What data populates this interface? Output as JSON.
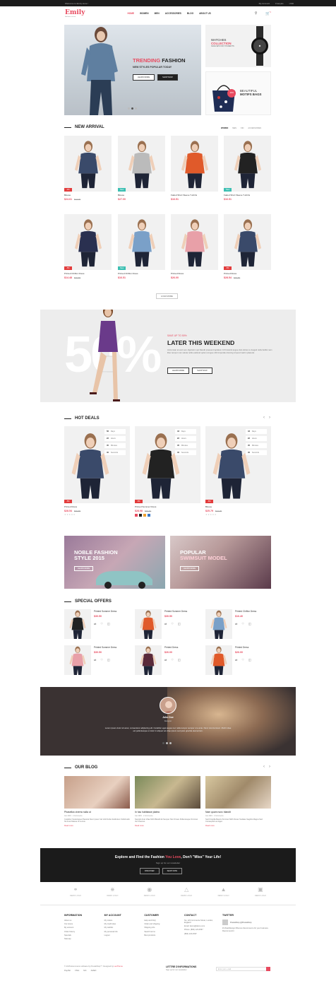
{
  "topbar": {
    "welcome": "Welcome to Emily store !",
    "account": "My Account",
    "language": "Français",
    "currency": "USD"
  },
  "header": {
    "logo": "Emily",
    "tagline": "fashion store",
    "nav": [
      "HOME",
      "WOMEN",
      "MEN",
      "ACCESSORIES",
      "BLOG",
      "ABOUT US"
    ],
    "cart_count": "0"
  },
  "hero": {
    "title_pink": "TRENDING",
    "title_dark": "FASHION",
    "subtitle": "NEW STYLES POPULAR TODAY",
    "btn_learn": "LEARN MORE",
    "btn_shop": "SHOP NOW"
  },
  "side1": {
    "l1": "WATCHES",
    "l2": "COLLECTION",
    "l3": "SAVE $25 FOR STUDENTS"
  },
  "side2": {
    "badge": "-30%",
    "l1": "BEAUTIFUL",
    "l2": "MOTIFS BAGS"
  },
  "new_arrival": {
    "title": "NEW ARRIVAL",
    "tabs": [
      "WOMEN",
      "MEN",
      "KID",
      "ACCESSORIES"
    ],
    "products": [
      {
        "name": "Blouse",
        "price": "$24.61",
        "old": "$27.00",
        "badge": "-1%"
      },
      {
        "name": "Blouse",
        "price": "$27.00",
        "old": "",
        "badge": "New"
      },
      {
        "name": "Faded Short Sleeve T-shirts",
        "price": "$16.51",
        "old": "",
        "badge": ""
      },
      {
        "name": "Faded Short Sleeve T-shirts",
        "price": "$16.51",
        "old": "",
        "badge": "New"
      },
      {
        "name": "Printed Chiffon Dress",
        "price": "$14.48",
        "old": "$20.50",
        "badge": "-5%"
      },
      {
        "name": "Printed Chiffon Dress",
        "price": "$16.51",
        "old": "",
        "badge": "New"
      },
      {
        "name": "Printed Dress",
        "price": "$26.00",
        "old": "",
        "badge": ""
      },
      {
        "name": "Printed Dress",
        "price": "$28.54",
        "old": "$30.50",
        "badge": "-5%"
      }
    ],
    "load_more": "LOAD MORE"
  },
  "promo": {
    "big": "50%",
    "save": "SAVE UP TO 50%",
    "title": "LATER THIS WEEKEND",
    "desc": "Accumsan at erat vero dignissim qui blandit praesent luptatum zzril delenit augue duis dolore te feugait nulla facilisi nam liber tempor cum soluta nobis eleifend option congue nihil imperdiet doming id quod mazim placerat.",
    "btn_learn": "LEARN MORE",
    "btn_shop": "SHOP NOW"
  },
  "hot_deals": {
    "title": "HOT DEALS",
    "count_labels": [
      "Days",
      "Hours",
      "Minutes",
      "Seconds"
    ],
    "items": [
      {
        "name": "Printed Dress",
        "price": "$28.54",
        "old": "$30.50",
        "badge": "-5%",
        "count": [
          "56",
          "22",
          "45",
          "40"
        ]
      },
      {
        "name": "Printed Summer Dress",
        "price": "$28.98",
        "old": "$30.51",
        "badge": "-5%",
        "count": [
          "43",
          "22",
          "45",
          "40"
        ]
      },
      {
        "name": "Blouse",
        "price": "$25.79",
        "old": "$27.00",
        "badge": "-5%",
        "count": [
          "43",
          "22",
          "45",
          "40"
        ]
      }
    ],
    "swatches": [
      "#e84a5f",
      "#222222",
      "#f0a030",
      "#3a78c8"
    ]
  },
  "banners": [
    {
      "l1": "NOBLE FASHION",
      "l2": "STYLE 2015",
      "btn": "LEARN MORE"
    },
    {
      "l1": "POPULAR",
      "l2": "SWIMSUIT MODEL",
      "btn": "LEARN MORE"
    }
  ],
  "special": {
    "title": "SPECIAL OFFERS",
    "items": [
      {
        "name": "Printed Summer Dress",
        "price": "$30.50"
      },
      {
        "name": "Printed Summer Dress",
        "price": "$30.50"
      },
      {
        "name": "Printed Chiffon Dress",
        "price": "$16.40"
      },
      {
        "name": "Printed Summer Dress",
        "price": "$30.50"
      },
      {
        "name": "Printed Dress",
        "price": "$26.00"
      },
      {
        "name": "Printed Dress",
        "price": "$26.00"
      }
    ]
  },
  "testimonial": {
    "name": "John Doe",
    "role": "Designer",
    "quote": "Lorem ipsum dolor sit amet, consectetur adipiscing elit. Curabitur eget augue nec nulla tempor semper ut a ante. Nunc viverra lorem. Morbi vitae est pellentesque ut dolor in aliquet vel vitae ipsum sed justo gravida elementum."
  },
  "blog": {
    "title": "OUR BLOG",
    "posts": [
      {
        "title": "Phasellus viverra nulla ut",
        "meta": "Jan 2015  ·  2 Comments",
        "desc": "Curabitur Scelerisque Placerat Nunc Ipsum Vel Velit Nulla Vestibulum Sollicitudin Sit Amet Massa Ut Luctus.",
        "more": "Read more"
      },
      {
        "title": "In hac habitasse platea",
        "meta": "Jan 2015  ·  2 Comments",
        "desc": "Suscipit Ante Vitae Nibh Blandit Et Semper Nisi Ornare Pellentesque Sit Amet Vel Vivamus.",
        "more": "Read more"
      },
      {
        "title": "Nam quam nunc blandit",
        "meta": "Jan 2015  ·  2 Comments",
        "desc": "Sed Fringilla Mauris Sit Amet Nibh Donec Sodales Sagittis Magna Sed Consequat Leo Eget.",
        "more": "Read more"
      }
    ]
  },
  "newsletter": {
    "pre": "Explore and Find the Fashion ",
    "pink": "You Love",
    "post": ", Don't \"Miss\" Your Life!",
    "sub": "Sign up for our newsletter",
    "btn_discover": "DISCOVER",
    "btn_shop": "SHOP NOW"
  },
  "brands": {
    "label": "DEMO LOGO",
    "icons": [
      "hat-icon",
      "sneaker-icon",
      "handbag-icon",
      "hanger-icon",
      "coat-icon",
      "bag-icon"
    ]
  },
  "footer": {
    "cols": [
      {
        "title": "INFORMATION",
        "items": [
          "About us",
          "Our stores",
          "My account",
          "Order history",
          "Specials",
          "Sitemap"
        ]
      },
      {
        "title": "MY ACCOUNT",
        "items": [
          "My orders",
          "My credit slips",
          "My wishlist",
          "My personal info",
          "Logout"
        ]
      },
      {
        "title": "CUSTOMER",
        "items": [
          "Help and FAQ",
          "Order and shipping",
          "Shipping info",
          "Search terms",
          "Best products"
        ]
      },
      {
        "title": "CONTACT",
        "items": [
          "No. 123 Commerce Street, London, England",
          "Email: demo@demo.com",
          "Phone: (800) 123-4567",
          "(800) 123-4567"
        ]
      }
    ],
    "twitter_title": "TWITTER",
    "twitter_user": "PrestaShop @PrestaShop",
    "tweet": "#1 #webDesign #themes #ecommerce for your business · Recommend it",
    "copyright_pre": "© 2015 Ecommerce software by PrestaShop™. Designed by ",
    "copyright_link": "LeoTheme",
    "payments": [
      "PayPal",
      "VISA",
      "MC",
      "AMEX"
    ],
    "newsletter_title": "LETTRE D'INFORMATIONS",
    "newsletter_sub": "Sign up for our newsletter",
    "newsletter_placeholder": "Enter your e-mail"
  },
  "colors": {
    "accent": "#e84a5f",
    "dark": "#1b1b1b"
  }
}
